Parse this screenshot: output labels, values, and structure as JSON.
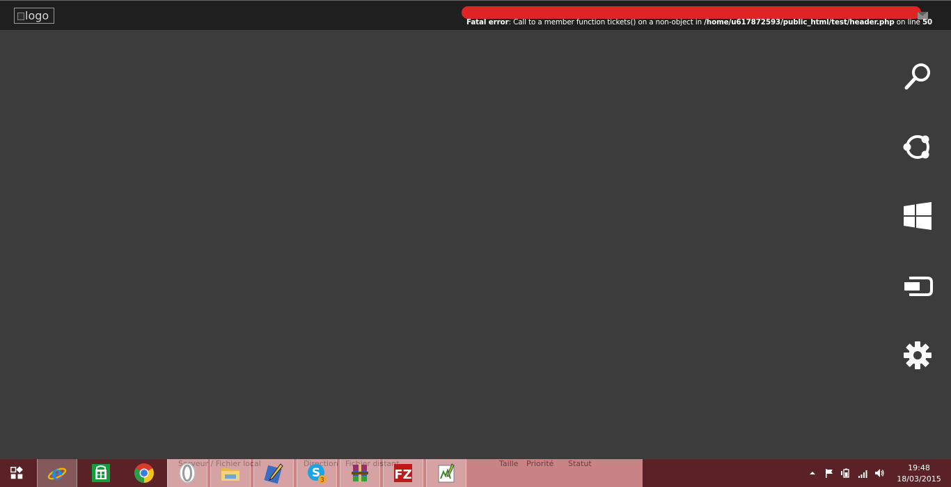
{
  "header": {
    "logo_alt": "logo",
    "error": {
      "label": "Fatal error",
      "message": ": Call to a member function tickets() on a non-object in ",
      "path": "/home/u617872593/public_html/test/header.php",
      "on_line": " on line ",
      "line": "50"
    }
  },
  "charms": [
    {
      "name": "Search",
      "icon": "search-icon"
    },
    {
      "name": "Share",
      "icon": "share-icon"
    },
    {
      "name": "Start",
      "icon": "windows-icon"
    },
    {
      "name": "Devices",
      "icon": "devices-icon"
    },
    {
      "name": "Settings",
      "icon": "gear-icon"
    }
  ],
  "taskbar": {
    "pane_labels": {
      "server_file": "Serveur / Fichier local",
      "direction": "Direction",
      "remote_file": "Fichier distant",
      "size": "Taille",
      "priority": "Priorité",
      "status": "Statut"
    },
    "apps": [
      {
        "name": "Internet Explorer",
        "icon": "ie-icon"
      },
      {
        "name": "Store",
        "icon": "store-icon"
      },
      {
        "name": "Chrome",
        "icon": "chrome-icon"
      },
      {
        "name": "Opera",
        "icon": "opera-icon"
      },
      {
        "name": "File Explorer",
        "icon": "folder-icon"
      },
      {
        "name": "Editor",
        "icon": "pen-icon"
      },
      {
        "name": "Skype",
        "icon": "skype-icon",
        "badge": "3"
      },
      {
        "name": "WinRAR",
        "icon": "winrar-icon"
      },
      {
        "name": "FileZilla",
        "icon": "filezilla-icon"
      },
      {
        "name": "Notepad++",
        "icon": "notepad-icon"
      }
    ],
    "clock": {
      "time": "19:48",
      "date": "18/03/2015"
    }
  },
  "colors": {
    "background": "#3c3c3c",
    "topbar": "#1f1f1f",
    "redaction": "#e02424",
    "taskbar": "#5a2226",
    "taskbar_pane": "#c98385"
  }
}
